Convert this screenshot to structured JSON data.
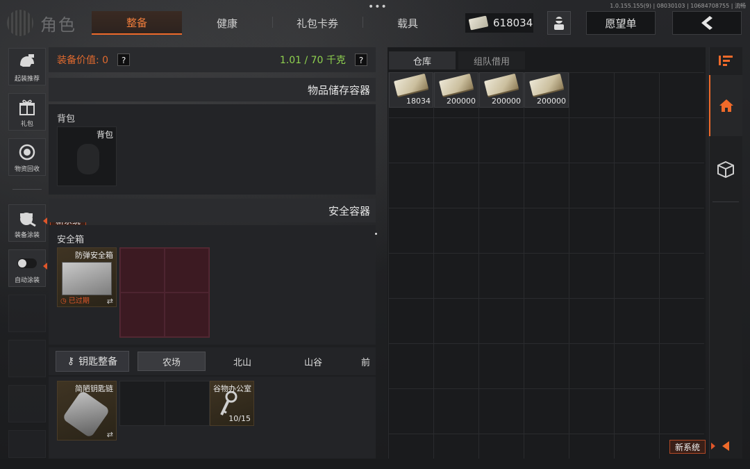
{
  "app": {
    "version": "1.0.155.155(9) | 08030103 | 10684708755 | 流畅",
    "title": "角色"
  },
  "topbar": {
    "tabs": [
      {
        "label": "整备",
        "active": true
      },
      {
        "label": "健康",
        "active": false
      },
      {
        "label": "礼包卡券",
        "active": false
      },
      {
        "label": "载具",
        "active": false
      }
    ],
    "money": "618034",
    "wishlist_label": "愿望单"
  },
  "sidebar": {
    "items": [
      {
        "label": "起装推荐",
        "icon": "helmet-icon"
      },
      {
        "label": "礼包",
        "icon": "gift-icon"
      },
      {
        "label": "物资回收",
        "icon": "recycle-icon"
      },
      {
        "label": "装备涂装",
        "icon": "paint-icon"
      },
      {
        "label": "自动涂装",
        "icon": "toggle-icon"
      }
    ],
    "new_badge": "新系统"
  },
  "equipment": {
    "value_label": "装备价值: 0",
    "help": "?",
    "weight": "1.01 / 70 千克",
    "storage_title": "物品储存容器",
    "backpack_label": "背包",
    "backpack_slot_label": "背包",
    "safe_title": "安全容器",
    "safe_label": "安全箱",
    "safe_item_name": "防弹安全箱",
    "safe_item_status": "已过期"
  },
  "keys": {
    "button_label": "钥匙整备",
    "tabs": [
      "农场",
      "北山",
      "山谷",
      "前"
    ],
    "chain_name": "简陋钥匙链",
    "key_name": "谷物办公室",
    "key_uses": "10/15"
  },
  "warehouse": {
    "tabs": [
      "仓库",
      "组队借用"
    ],
    "items": [
      "18034",
      "200000",
      "200000",
      "200000"
    ]
  },
  "colors": {
    "accent": "#ef6a2a",
    "weight": "#8fd14f"
  }
}
